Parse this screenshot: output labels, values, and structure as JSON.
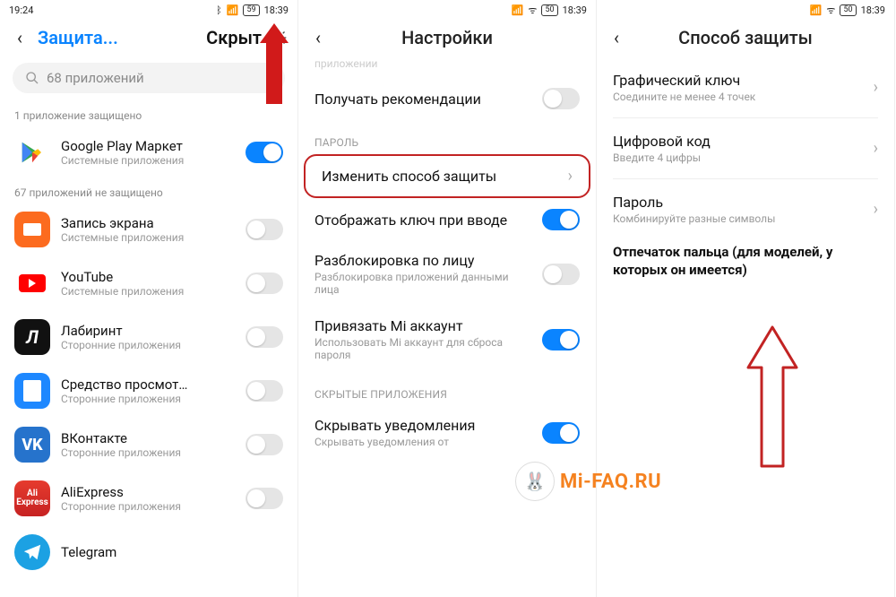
{
  "panel1": {
    "status": {
      "left_time": "19:24",
      "battery": "59",
      "right_time": "18:39"
    },
    "title_left": "Защита...",
    "title_right": "Скрыт",
    "search_placeholder": "68 приложений",
    "protected_caption": "1 приложение защищено",
    "unprotected_caption": "67 приложений не защищено",
    "apps": [
      {
        "name": "Google Play Маркет",
        "sub": "Системные приложения",
        "on": true
      },
      {
        "name": "Запись экрана",
        "sub": "Системные приложения",
        "on": false
      },
      {
        "name": "YouTube",
        "sub": "Системные приложения",
        "on": false
      },
      {
        "name": "Лабиринт",
        "sub": "Сторонние приложения",
        "on": false
      },
      {
        "name": "Средство просмот…",
        "sub": "Сторонние приложения",
        "on": false
      },
      {
        "name": "ВКонтакте",
        "sub": "Сторонние приложения",
        "on": false
      },
      {
        "name": "AliExpress",
        "sub": "Сторонние приложения",
        "on": false
      },
      {
        "name": "Telegram",
        "sub": "",
        "on": false
      }
    ]
  },
  "panel2": {
    "status": {
      "battery": "50",
      "right_time": "18:39"
    },
    "title": "Настройки",
    "faded": "приложении",
    "recommend": "Получать рекомендации",
    "section_password": "ПАРОЛЬ",
    "change_method": "Изменить способ защиты",
    "show_key": "Отображать ключ при вводе",
    "face_unlock_title": "Разблокировка по лицу",
    "face_unlock_sub": "Разблокировка приложений данными лица",
    "bind_mi_title": "Привязать Mi аккаунт",
    "bind_mi_sub": "Использовать Mi аккаунт для сброса пароля",
    "section_hidden": "СКРЫТЫЕ ПРИЛОЖЕНИЯ",
    "hide_notif_title": "Скрывать уведомления",
    "hide_notif_sub": "Скрывать уведомления от"
  },
  "panel3": {
    "status": {
      "battery": "50",
      "right_time": "18:39"
    },
    "title": "Способ защиты",
    "methods": [
      {
        "title": "Графический ключ",
        "sub": "Соедините не менее 4 точек"
      },
      {
        "title": "Цифровой код",
        "sub": "Введите 4 цифры"
      },
      {
        "title": "Пароль",
        "sub": "Комбинируйте разные символы"
      }
    ],
    "fingerprint_note": "Отпечаток пальца (для моделей, у которых он имеется)"
  },
  "watermark": {
    "text": "Mi-FAQ.RU"
  }
}
